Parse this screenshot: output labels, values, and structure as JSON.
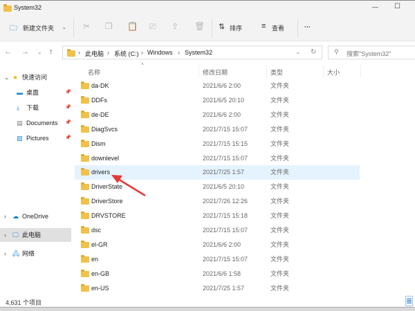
{
  "window": {
    "title": "System32",
    "minimize": "—",
    "maximize": "☐"
  },
  "toolbar": {
    "new_folder": "新建文件夹",
    "sort": "排序",
    "view": "查看",
    "more": "···"
  },
  "address": {
    "parts": [
      "此电脑",
      "系统 (C:)",
      "Windows",
      "System32"
    ],
    "search_placeholder": "搜索\"System32\""
  },
  "sidebar": {
    "quick_access": "快速访问",
    "items": [
      {
        "label": "桌面",
        "icon": "desktop-icon"
      },
      {
        "label": "下载",
        "icon": "download-icon"
      },
      {
        "label": "Documents",
        "icon": "documents-icon"
      },
      {
        "label": "Pictures",
        "icon": "pictures-icon"
      }
    ],
    "onedrive": "OneDrive",
    "this_pc": "此电脑",
    "network": "网络"
  },
  "columns": {
    "name": "名称",
    "date": "修改日期",
    "type": "类型",
    "size": "大小"
  },
  "files": [
    {
      "name": "da-DK",
      "date": "2021/6/6 2:00",
      "type": "文件夹"
    },
    {
      "name": "DDFs",
      "date": "2021/6/5 20:10",
      "type": "文件夹"
    },
    {
      "name": "de-DE",
      "date": "2021/6/6 2:00",
      "type": "文件夹"
    },
    {
      "name": "DiagSvcs",
      "date": "2021/7/15 15:07",
      "type": "文件夹"
    },
    {
      "name": "Dism",
      "date": "2021/7/15 15:15",
      "type": "文件夹"
    },
    {
      "name": "downlevel",
      "date": "2021/7/15 15:07",
      "type": "文件夹"
    },
    {
      "name": "drivers",
      "date": "2021/7/25 1:57",
      "type": "文件夹",
      "selected": true
    },
    {
      "name": "DriverState",
      "date": "2021/6/5 20:10",
      "type": "文件夹"
    },
    {
      "name": "DriverStore",
      "date": "2021/7/26 12:26",
      "type": "文件夹"
    },
    {
      "name": "DRVSTORE",
      "date": "2021/7/15 15:18",
      "type": "文件夹"
    },
    {
      "name": "dsc",
      "date": "2021/7/15 15:07",
      "type": "文件夹"
    },
    {
      "name": "el-GR",
      "date": "2021/6/6 2:00",
      "type": "文件夹"
    },
    {
      "name": "en",
      "date": "2021/7/15 15:07",
      "type": "文件夹"
    },
    {
      "name": "en-GB",
      "date": "2021/6/6 1:58",
      "type": "文件夹"
    },
    {
      "name": "en-US",
      "date": "2021/7/25 1:57",
      "type": "文件夹"
    }
  ],
  "status": {
    "count": "4,631 个项目"
  },
  "colors": {
    "accent": "#0067c0",
    "selected_row": "#e5f3ff",
    "arrow": "#e53935"
  }
}
